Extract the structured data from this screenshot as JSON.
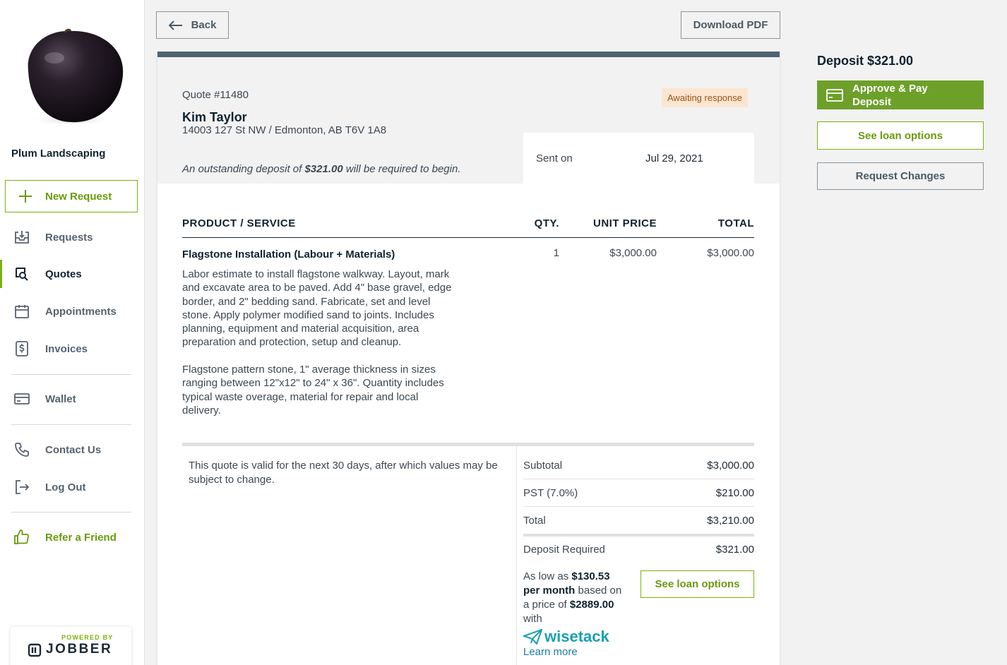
{
  "company": {
    "name": "Plum Landscaping"
  },
  "sidebar": {
    "new_request": "New Request",
    "items": [
      {
        "label": "Requests"
      },
      {
        "label": "Quotes"
      },
      {
        "label": "Appointments"
      },
      {
        "label": "Invoices"
      },
      {
        "label": "Wallet"
      },
      {
        "label": "Contact Us"
      },
      {
        "label": "Log Out"
      },
      {
        "label": "Refer a Friend"
      }
    ],
    "powered_by": "POWERED BY",
    "brand": "JOBBER"
  },
  "toolbar": {
    "back_label": "Back",
    "download_label": "Download PDF"
  },
  "quote": {
    "number": "Quote #11480",
    "status": "Awaiting response",
    "client_name": "Kim Taylor",
    "client_address": "14003 127 St NW / Edmonton, AB T6V 1A8",
    "deposit_note_pre": "An outstanding deposit of ",
    "deposit_note_amount": "$321.00",
    "deposit_note_post": " will be required to begin.",
    "sent_label": "Sent on",
    "sent_date": "Jul 29, 2021"
  },
  "table": {
    "headers": {
      "product": "PRODUCT / SERVICE",
      "qty": "QTY.",
      "unit_price": "UNIT PRICE",
      "total": "TOTAL"
    },
    "items": [
      {
        "name": "Flagstone Installation (Labour + Materials)",
        "description": "Labor estimate to install flagstone walkway. Layout, mark and excavate area to be paved. Add 4\" base gravel, edge border, and 2\" bedding sand. Fabricate, set and level stone. Apply polymer modified sand to joints. Includes planning, equipment and material acquisition, area preparation and protection, setup and cleanup.\n\nFlagstone pattern stone, 1\" average thickness in sizes ranging between 12\"x12\" to 24\" x 36\". Quantity includes typical waste overage, material for repair and local delivery.",
        "qty": "1",
        "unit_price": "$3,000.00",
        "total": "$3,000.00"
      }
    ]
  },
  "summary": {
    "validity": "This quote is valid for the next 30 days, after which values may be subject to change.",
    "rows": [
      {
        "label": "Subtotal",
        "value": "$3,000.00"
      },
      {
        "label": "PST (7.0%)",
        "value": "$210.00"
      },
      {
        "label": "Total",
        "value": "$3,210.00"
      },
      {
        "label": "Deposit Required",
        "value": "$321.00"
      }
    ]
  },
  "financing": {
    "as_low_as": "As low as ",
    "monthly": "$130.53 per month",
    "based_on": " based on a price of ",
    "price": "$2889.00",
    "with": " with",
    "brand": "wisetack",
    "learn_more": "Learn more",
    "button": "See loan options"
  },
  "panel": {
    "deposit_title": "Deposit $321.00",
    "approve_label": "Approve & Pay Deposit",
    "loan_label": "See loan options",
    "changes_label": "Request Changes"
  },
  "colors": {
    "brand_green": "#7db00e",
    "approve_green": "#6da029",
    "card_bar": "#4f6370",
    "badge_bg": "#fbe6d1"
  }
}
